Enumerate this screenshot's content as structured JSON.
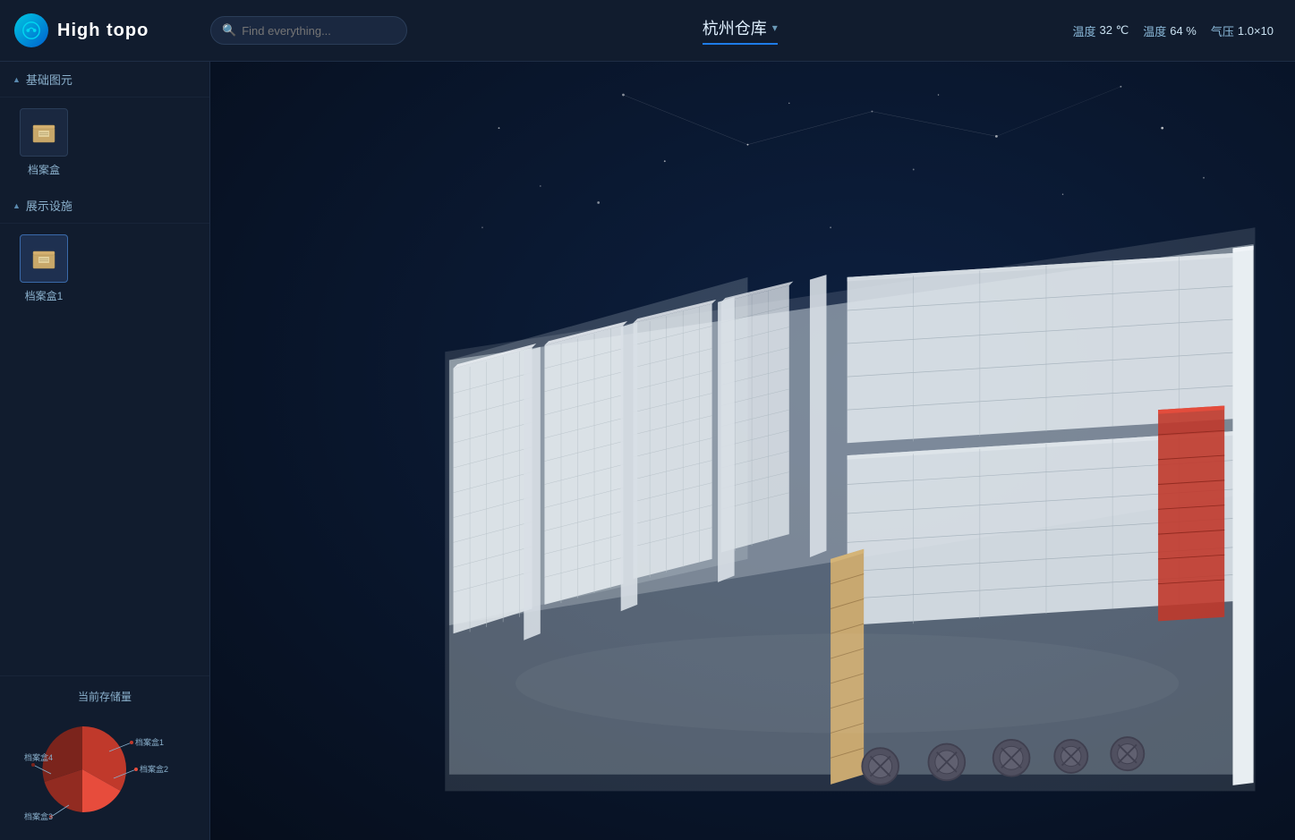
{
  "app": {
    "name": "High topo"
  },
  "topbar": {
    "search_placeholder": "Find everything...",
    "warehouse_name": "杭州仓库",
    "chevron": "▾",
    "status": [
      {
        "label": "温度",
        "value": "32 ℃"
      },
      {
        "label": "温度",
        "value": "64 %"
      },
      {
        "label": "气压",
        "value": "1.0×10"
      }
    ]
  },
  "sidebar": {
    "sections": [
      {
        "name": "基础图元",
        "items": [
          {
            "label": "档案盒",
            "selected": false
          }
        ]
      },
      {
        "name": "展示设施",
        "items": [
          {
            "label": "档案盒1",
            "selected": true
          }
        ]
      }
    ]
  },
  "chart": {
    "title": "当前存储量",
    "segments": [
      {
        "label": "档案盒1",
        "value": 35,
        "color": "#c0392b"
      },
      {
        "label": "档案盒2",
        "value": 25,
        "color": "#e74c3c"
      },
      {
        "label": "档案盒3",
        "value": 20,
        "color": "#922b21"
      },
      {
        "label": "档案盒4",
        "value": 20,
        "color": "#7b241c"
      }
    ]
  },
  "icons": {
    "logo": "H",
    "search": "🔍",
    "triangle_down": "▲",
    "triangle_right": "▶"
  }
}
